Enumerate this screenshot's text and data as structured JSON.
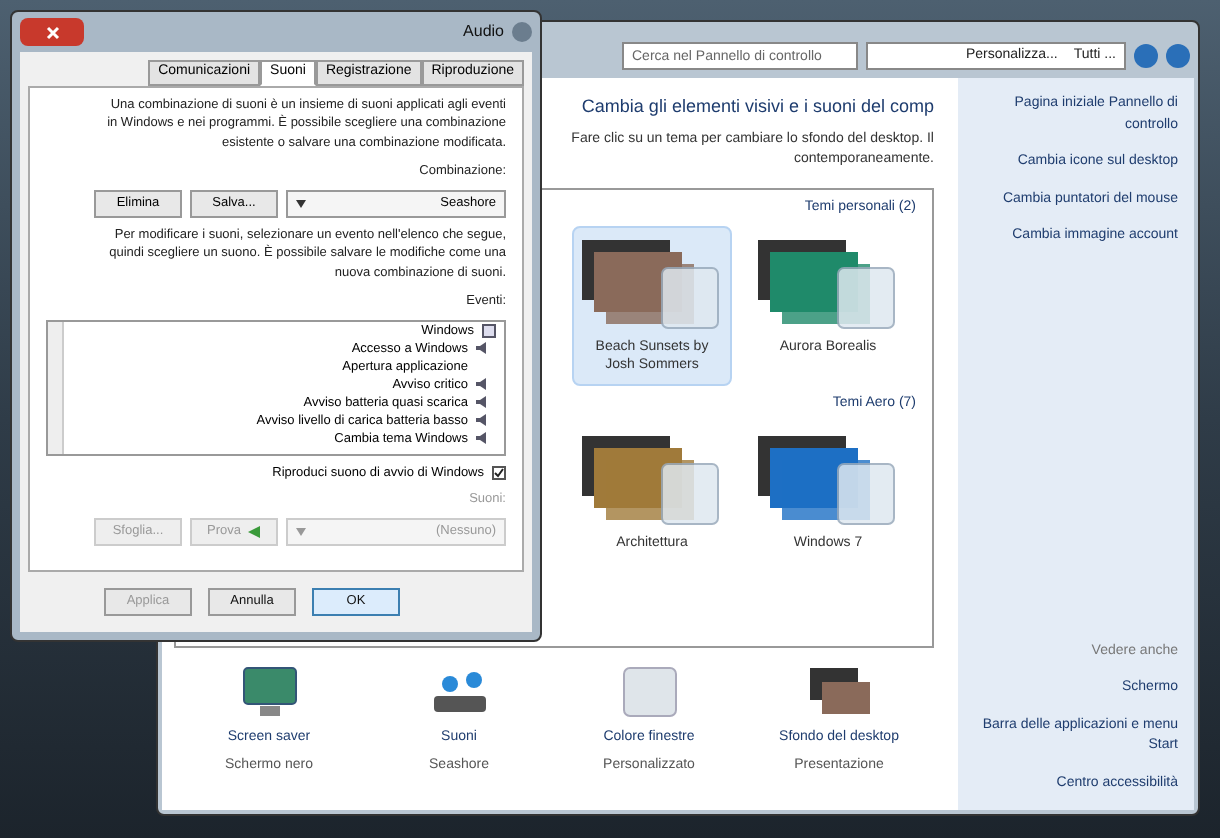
{
  "control_panel": {
    "breadcrumb": [
      "Personalizza...",
      "Tutti ..."
    ],
    "search": {
      "placeholder": "Cerca nel Pannello di controllo"
    },
    "sidebar": {
      "items": [
        "Pagina iniziale Pannello di controllo",
        "Cambia icone sul desktop",
        "Cambia puntatori del mouse",
        "Cambia immagine account"
      ],
      "see_also_title": "Vedere anche",
      "see_also": [
        "Schermo",
        "Barra delle applicazioni e menu Start",
        "Centro accessibilità"
      ]
    },
    "heading": "Cambia gli elementi visivi e i suoni del comp",
    "description": "Fare clic su un tema per cambiare lo sfondo del desktop. Il contemporaneamente.",
    "theme_groups": [
      {
        "title": "Temi personali (2)",
        "themes": [
          {
            "name": "Beach Sunsets by Josh Sommers",
            "selected": true,
            "color": "#8a6a5a"
          },
          {
            "name": "Aurora Borealis",
            "selected": false,
            "color": "#1f8a6a"
          }
        ]
      },
      {
        "title": "Temi Aero (7)",
        "themes": [
          {
            "name": "Architettura",
            "selected": false,
            "color": "#a07a3a"
          },
          {
            "name": "Windows 7",
            "selected": false,
            "color": "#1d6fc4"
          }
        ]
      }
    ],
    "settings": [
      {
        "kind": "screensaver",
        "label": "Screen saver",
        "value": "Schermo nero"
      },
      {
        "kind": "sound",
        "label": "Suoni",
        "value": "Seashore"
      },
      {
        "kind": "color",
        "label": "Colore finestre",
        "value": "Personalizzato"
      },
      {
        "kind": "wallpaper",
        "label": "Sfondo del desktop",
        "value": "Presentazione"
      }
    ]
  },
  "dialog": {
    "title": "Audio",
    "tabs": [
      {
        "label": "Comunicazioni",
        "selected": false
      },
      {
        "label": "Suoni",
        "selected": true
      },
      {
        "label": "Registrazione",
        "selected": false
      },
      {
        "label": "Riproduzione",
        "selected": false
      }
    ],
    "intro": "Una combinazione di suoni è un insieme di suoni applicati agli eventi in Windows e nei programmi. È possibile scegliere una combinazione esistente o salvare una combinazione modificata.",
    "scheme_label": "Combinazione:",
    "scheme": "Seashore",
    "save_button": "Salva...",
    "delete_button": "Elimina",
    "hint": "Per modificare i suoni, selezionare un evento nell'elenco che segue, quindi scegliere un suono. È possibile salvare le modifiche come una nuova combinazione di suoni.",
    "events_label": "Eventi:",
    "events": [
      {
        "name": "Windows",
        "children": [
          {
            "name": "Accesso a Windows",
            "has_sound": true
          },
          {
            "name": "Apertura applicazione",
            "has_sound": false
          },
          {
            "name": "Avviso critico",
            "has_sound": true
          },
          {
            "name": "Avviso batteria quasi scarica",
            "has_sound": true
          },
          {
            "name": "Avviso livello di carica batteria basso",
            "has_sound": true
          },
          {
            "name": "Cambia tema Windows",
            "has_sound": true
          }
        ]
      }
    ],
    "startup_sound": {
      "label": "Riproduci suono di avvio di Windows",
      "checked": true
    },
    "sounds_label": "Suoni:",
    "sound": "(Nessuno)",
    "test_button": "Prova",
    "browse_button": "Sfoglia...",
    "buttons": [
      {
        "label": "Applica",
        "kind": "normal",
        "disabled": true
      },
      {
        "label": "Annulla",
        "kind": "normal",
        "disabled": false
      },
      {
        "label": "OK",
        "kind": "default",
        "disabled": false
      }
    ]
  }
}
